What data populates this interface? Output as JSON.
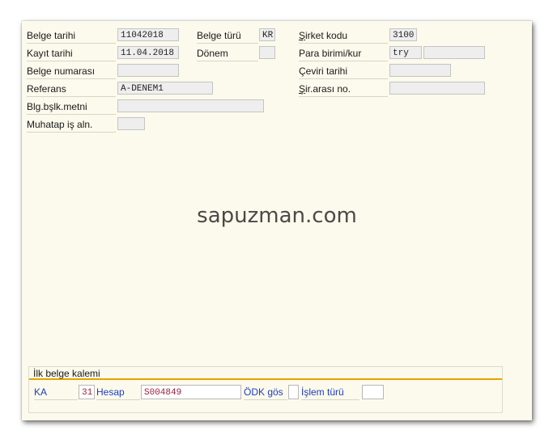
{
  "header": {
    "belge_tarihi_label": "Belge tarihi",
    "belge_tarihi_value": "11042018",
    "kayit_tarihi_label": "Kayıt tarihi",
    "kayit_tarihi_value": "11.04.2018",
    "belge_numarasi_label": "Belge numarası",
    "belge_numarasi_value": "",
    "referans_label": "Referans",
    "referans_value": "A-DENEM1",
    "blg_metni_label": "Blg.bşlk.metni",
    "blg_metni_value": "",
    "muhatap_label": "Muhatap iş aln.",
    "muhatap_value": "",
    "belge_turu_label": "Belge türü",
    "belge_turu_value": "KR",
    "donem_label": "Dönem",
    "donem_value": "",
    "sirket_kodu_label": "Şirket kodu",
    "sirket_kodu_value": "3100",
    "para_birimi_label": "Para birimi/kur",
    "para_birimi_value": "try",
    "kur_value": "",
    "ceviri_tarihi_label": "Çeviri tarihi",
    "ceviri_tarihi_value": "",
    "sir_arasi_label": "Şir.arası no.",
    "sir_arasi_value": ""
  },
  "watermark": "sapuzman.com",
  "first_item": {
    "title": "İlk belge kalemi",
    "ka_label": "KA",
    "posting_key": "31",
    "hesap_label": "Hesap",
    "hesap_value": "S004849",
    "odk_label": "ÖDK gös",
    "odk_value": "",
    "islem_turu_label": "İşlem türü",
    "islem_turu_value": ""
  },
  "colors": {
    "panel_bg": "#fbfaec",
    "accent_line": "#e6a300",
    "link_blue": "#1f3dbf",
    "value_red": "#a0203a"
  }
}
